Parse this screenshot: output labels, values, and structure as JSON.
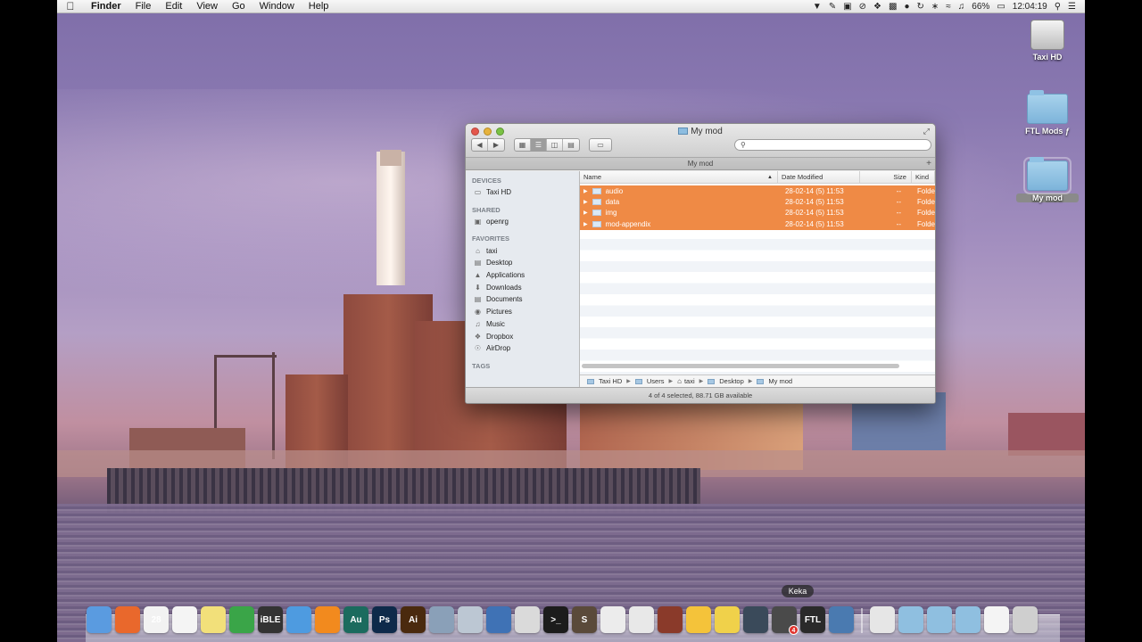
{
  "menubar": {
    "app_name": "Finder",
    "items": [
      "File",
      "Edit",
      "View",
      "Go",
      "Window",
      "Help"
    ],
    "battery": "66%",
    "clock": "12:04:19"
  },
  "desktop_icons": [
    {
      "label": "Taxi HD",
      "type": "drive"
    },
    {
      "label": "FTL Mods ƒ",
      "type": "folder"
    },
    {
      "label": "My mod",
      "type": "folder",
      "selected": true
    }
  ],
  "window": {
    "title": "My mod",
    "tab_label": "My mod",
    "search_placeholder": "",
    "sidebar": {
      "sections": [
        {
          "heading": "DEVICES",
          "items": [
            {
              "label": "Taxi HD",
              "icon": "hard-drive-icon"
            }
          ]
        },
        {
          "heading": "SHARED",
          "items": [
            {
              "label": "openrg",
              "icon": "network-computer-icon"
            }
          ]
        },
        {
          "heading": "FAVORITES",
          "items": [
            {
              "label": "taxi",
              "icon": "home-icon"
            },
            {
              "label": "Desktop",
              "icon": "desktop-icon"
            },
            {
              "label": "Applications",
              "icon": "applications-icon"
            },
            {
              "label": "Downloads",
              "icon": "downloads-icon"
            },
            {
              "label": "Documents",
              "icon": "documents-icon"
            },
            {
              "label": "Pictures",
              "icon": "camera-icon"
            },
            {
              "label": "Music",
              "icon": "music-note-icon"
            },
            {
              "label": "Dropbox",
              "icon": "dropbox-icon"
            },
            {
              "label": "AirDrop",
              "icon": "airdrop-icon"
            }
          ]
        },
        {
          "heading": "TAGS",
          "items": []
        }
      ]
    },
    "columns": {
      "name": "Name",
      "date": "Date Modified",
      "size": "Size",
      "kind": "Kind"
    },
    "rows": [
      {
        "name": "audio",
        "date": "28-02-14 (5) 11:53",
        "size": "--",
        "kind": "Folde"
      },
      {
        "name": "data",
        "date": "28-02-14 (5) 11:53",
        "size": "--",
        "kind": "Folde"
      },
      {
        "name": "img",
        "date": "28-02-14 (5) 11:53",
        "size": "--",
        "kind": "Folde"
      },
      {
        "name": "mod-appendix",
        "date": "28-02-14 (5) 11:53",
        "size": "--",
        "kind": "Folde"
      }
    ],
    "path": [
      "Taxi HD",
      "Users",
      "taxi",
      "Desktop",
      "My mod"
    ],
    "status": "4 of 4 selected, 88.71 GB available"
  },
  "dock": {
    "tooltip": "Keka",
    "items": [
      {
        "icon": "finder-icon",
        "text": "",
        "color": "#5a9be0"
      },
      {
        "icon": "firefox-icon",
        "text": "",
        "color": "#e9682c"
      },
      {
        "icon": "calendar-icon",
        "text": "28",
        "color": "#f2f2f2"
      },
      {
        "icon": "reminders-icon",
        "text": "",
        "color": "#f4f4f4"
      },
      {
        "icon": "stickies-icon",
        "text": "",
        "color": "#f2e07a"
      },
      {
        "icon": "evernote-icon",
        "text": "",
        "color": "#3aa548"
      },
      {
        "icon": "ible-icon",
        "text": "iBLE",
        "color": "#333333"
      },
      {
        "icon": "itunes-icon",
        "text": "",
        "color": "#4e9be0"
      },
      {
        "icon": "vlc-icon",
        "text": "",
        "color": "#f28a1e"
      },
      {
        "icon": "audition-icon",
        "text": "Au",
        "color": "#1b6b5e"
      },
      {
        "icon": "photoshop-icon",
        "text": "Ps",
        "color": "#0e2a4a"
      },
      {
        "icon": "illustrator-icon",
        "text": "Ai",
        "color": "#4a2a0e"
      },
      {
        "icon": "preview-icon",
        "text": "",
        "color": "#8aa0b8"
      },
      {
        "icon": "safari-compass-icon",
        "text": "",
        "color": "#bcc7d3"
      },
      {
        "icon": "virtualbox-icon",
        "text": "",
        "color": "#3f72b5"
      },
      {
        "icon": "script-editor-icon",
        "text": "",
        "color": "#dadada"
      },
      {
        "icon": "terminal-icon",
        "text": ">_",
        "color": "#1c1c1c"
      },
      {
        "icon": "sublime-icon",
        "text": "S",
        "color": "#5a4a3a"
      },
      {
        "icon": "textedit-icon",
        "text": "",
        "color": "#ececec"
      },
      {
        "icon": "font-book-icon",
        "text": "",
        "color": "#e8e8e8"
      },
      {
        "icon": "game-character-icon",
        "text": "",
        "color": "#8a3a2a"
      },
      {
        "icon": "weather-icon",
        "text": "",
        "color": "#f4c33a"
      },
      {
        "icon": "star-badge-icon",
        "text": "",
        "color": "#f0d14a"
      },
      {
        "icon": "alien-icon",
        "text": "",
        "color": "#3a4a5a"
      },
      {
        "icon": "keka-icon",
        "text": "",
        "color": "#4a4a4a",
        "badge": "4"
      },
      {
        "icon": "ftl-icon",
        "text": "FTL",
        "color": "#2a2a2a"
      },
      {
        "icon": "photo-booth-icon",
        "text": "",
        "color": "#4a7ab0"
      }
    ],
    "right_items": [
      {
        "icon": "jar-file-icon",
        "text": "",
        "color": "#e6e6e6"
      },
      {
        "icon": "applications-stack-icon",
        "text": "",
        "color": "#8fbfe0"
      },
      {
        "icon": "documents-stack-icon",
        "text": "",
        "color": "#8fbfe0"
      },
      {
        "icon": "downloads-stack-icon",
        "text": "",
        "color": "#8fbfe0"
      },
      {
        "icon": "window-stack-icon",
        "text": "",
        "color": "#f4f4f4"
      },
      {
        "icon": "trash-icon",
        "text": "",
        "color": "#cfcfcf"
      }
    ]
  }
}
